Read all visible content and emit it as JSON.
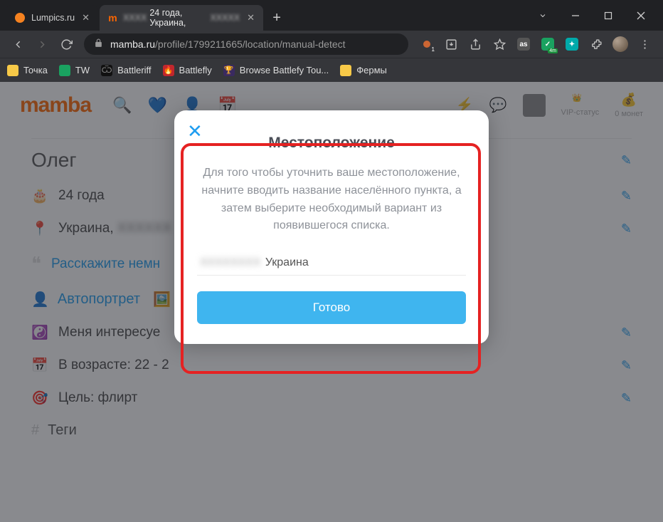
{
  "browser": {
    "tabs": [
      {
        "title": "Lumpics.ru",
        "favicon_color": "#f58220"
      },
      {
        "title_prefix_blurred": "XXXX",
        "title_mid": "24 года, Украина,",
        "title_suffix_blurred": "XXXXX",
        "favicon_letter": "m",
        "favicon_color": "#ff6600"
      }
    ],
    "url_host": "mamba.ru",
    "url_path": "/profile/1799211665/location/manual-detect",
    "ext_badge": "4m"
  },
  "bookmarks": [
    {
      "label": "Точка",
      "color": "#f7c948"
    },
    {
      "label": "TW",
      "color": "#1aa260"
    },
    {
      "label": "Battleriff",
      "color": "#3a3a3a"
    },
    {
      "label": "Battlefly",
      "color": "#c1272d"
    },
    {
      "label": "Browse Battlefy Tou...",
      "color": "#5b3fa0"
    },
    {
      "label": "Фермы",
      "color": "#f7c948"
    }
  ],
  "header": {
    "logo": "mamba",
    "right": {
      "vip_label": "VIP-статус",
      "coins_label": "0 монет"
    }
  },
  "profile": {
    "name": "Олег",
    "age_line": "24 года",
    "location_prefix": "Украина,",
    "location_blurred": "XXXXXX",
    "tagline": "Расскажите немн",
    "section_selfportrait": "Автопортрет",
    "interests_line": "Меня интересуе",
    "age_range_line": "В возрасте: 22 - 2",
    "goal_line": "Цель: флирт",
    "tags_label": "Теги"
  },
  "modal": {
    "title": "Местоположение",
    "description": "Для того чтобы уточнить ваше местоположение, начните вводить название населённого пункта, а затем выберите необходимый вариант из появившегося списка.",
    "input_blurred_city": "XXXXXXXX",
    "input_country": "Украина",
    "submit_label": "Готово"
  }
}
